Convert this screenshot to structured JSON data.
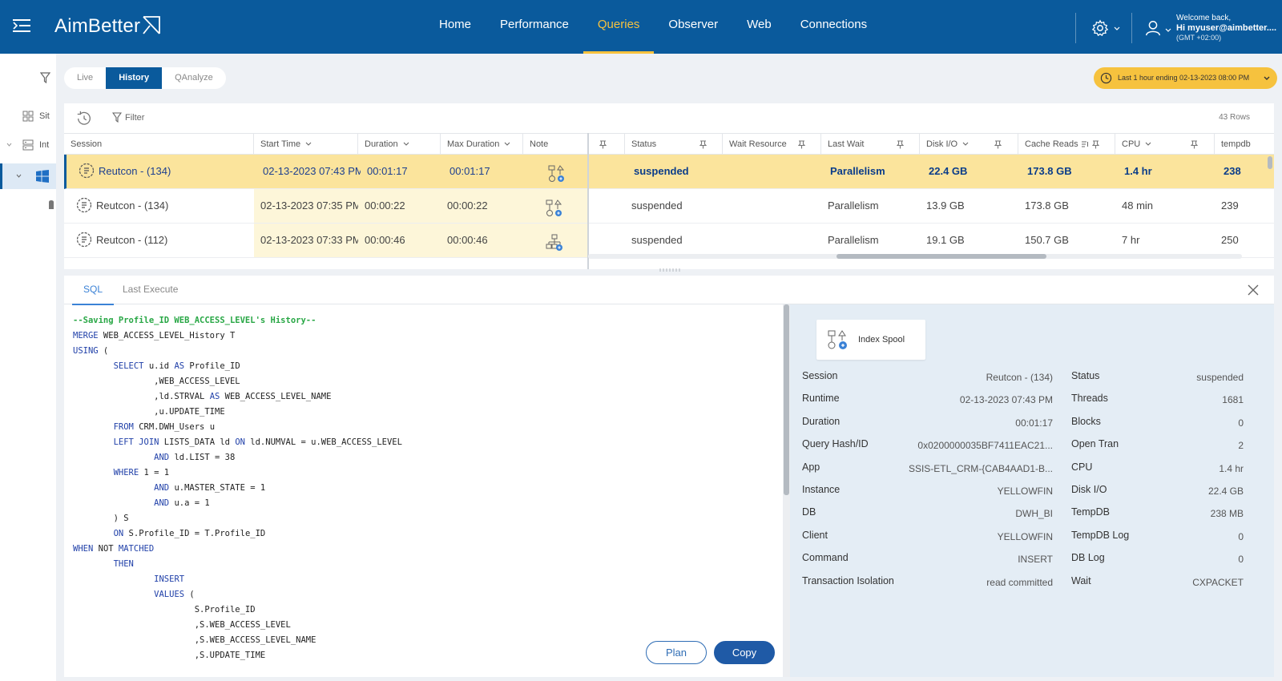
{
  "app": {
    "logo": "AimBetter"
  },
  "nav": {
    "items": [
      "Home",
      "Performance",
      "Queries",
      "Observer",
      "Web",
      "Connections"
    ],
    "active": "Queries"
  },
  "user": {
    "welcome": "Welcome back,",
    "greeting": "Hi myuser@aimbetter....",
    "timezone": "(GMT +02:00)"
  },
  "rail": {
    "items": [
      {
        "label": "Sit",
        "icon": "grid-icon"
      },
      {
        "label": "Int",
        "icon": "server-icon"
      },
      {
        "label": "",
        "icon": "windows-icon"
      }
    ]
  },
  "modes": {
    "items": [
      "Live",
      "History",
      "QAnalyze"
    ],
    "active": "History"
  },
  "time_range": {
    "label": "Last 1 hour ending  02-13-2023 08:00 PM"
  },
  "grid": {
    "filter_label": "Filter",
    "row_count": "43 Rows",
    "columns": [
      "Session",
      "Start Time",
      "Duration",
      "Max Duration",
      "Note",
      "Status",
      "Wait Resource",
      "Last Wait",
      "Disk I/O",
      "Cache Reads",
      "CPU",
      "tempdb"
    ],
    "rows": [
      {
        "session": "Reutcon - (134)",
        "start": "02-13-2023 07:43 PM",
        "duration": "00:01:17",
        "max_duration": "00:01:17",
        "status": "suspended",
        "wait_resource": "",
        "last_wait": "Parallelism",
        "disk_io": "22.4 GB",
        "cache_reads": "173.8 GB",
        "cpu": "1.4 hr",
        "tempdb": "238",
        "selected": true
      },
      {
        "session": "Reutcon - (134)",
        "start": "02-13-2023 07:35 PM",
        "duration": "00:00:22",
        "max_duration": "00:00:22",
        "status": "suspended",
        "wait_resource": "",
        "last_wait": "Parallelism",
        "disk_io": "13.9 GB",
        "cache_reads": "173.8 GB",
        "cpu": "48 min",
        "tempdb": "239",
        "selected": false
      },
      {
        "session": "Reutcon - (112)",
        "start": "02-13-2023 07:33 PM",
        "duration": "00:00:46",
        "max_duration": "00:00:46",
        "status": "suspended",
        "wait_resource": "",
        "last_wait": "Parallelism",
        "disk_io": "19.1 GB",
        "cache_reads": "150.7 GB",
        "cpu": "7 hr",
        "tempdb": "250",
        "selected": false
      }
    ]
  },
  "detail": {
    "tabs": [
      "SQL",
      "Last Execute"
    ],
    "active_tab": "SQL",
    "sql_lines": [
      [
        [
          "--Saving Profile_ID WEB_ACCESS_LEVEL's History--",
          "cm"
        ]
      ],
      [
        [
          "MERGE",
          "k"
        ],
        [
          " WEB_ACCESS_LEVEL_History T",
          ""
        ]
      ],
      [
        [
          "USING",
          "k"
        ],
        [
          " (",
          ""
        ]
      ],
      [
        [
          "        ",
          ""
        ],
        [
          "SELECT",
          "k"
        ],
        [
          " u.id ",
          ""
        ],
        [
          "AS",
          "k"
        ],
        [
          " Profile_ID",
          ""
        ]
      ],
      [
        [
          "                ,WEB_ACCESS_LEVEL",
          ""
        ]
      ],
      [
        [
          "                ,ld.STRVAL ",
          ""
        ],
        [
          "AS",
          "k"
        ],
        [
          " WEB_ACCESS_LEVEL_NAME",
          ""
        ]
      ],
      [
        [
          "                ,u.UPDATE_TIME",
          ""
        ]
      ],
      [
        [
          "        ",
          ""
        ],
        [
          "FROM",
          "k"
        ],
        [
          " CRM.DWH_Users u",
          ""
        ]
      ],
      [
        [
          "        ",
          ""
        ],
        [
          "LEFT JOIN",
          "k"
        ],
        [
          " LISTS_DATA ld ",
          ""
        ],
        [
          "ON",
          "k"
        ],
        [
          " ld.NUMVAL = u.WEB_ACCESS_LEVEL",
          ""
        ]
      ],
      [
        [
          "                ",
          ""
        ],
        [
          "AND",
          "k"
        ],
        [
          " ld.LIST = 38",
          ""
        ]
      ],
      [
        [
          "        ",
          ""
        ],
        [
          "WHERE",
          "k"
        ],
        [
          " 1 = 1",
          ""
        ]
      ],
      [
        [
          "                ",
          ""
        ],
        [
          "AND",
          "k"
        ],
        [
          " u.MASTER_STATE = 1",
          ""
        ]
      ],
      [
        [
          "                ",
          ""
        ],
        [
          "AND",
          "k"
        ],
        [
          " u.a = 1",
          ""
        ]
      ],
      [
        [
          "        ) S",
          ""
        ]
      ],
      [
        [
          "        ",
          ""
        ],
        [
          "ON",
          "k"
        ],
        [
          " S.Profile_ID = T.Profile_ID",
          ""
        ]
      ],
      [
        [
          "WHEN",
          "k"
        ],
        [
          " NOT ",
          ""
        ],
        [
          "MATCHED",
          "k"
        ]
      ],
      [
        [
          "        ",
          ""
        ],
        [
          "THEN",
          "k"
        ]
      ],
      [
        [
          "                ",
          ""
        ],
        [
          "INSERT",
          "k"
        ]
      ],
      [
        [
          "                ",
          ""
        ],
        [
          "VALUES",
          "k"
        ],
        [
          " (",
          ""
        ]
      ],
      [
        [
          "                        S.Profile_ID",
          ""
        ]
      ],
      [
        [
          "                        ,S.WEB_ACCESS_LEVEL",
          ""
        ]
      ],
      [
        [
          "                        ,S.WEB_ACCESS_LEVEL_NAME",
          ""
        ]
      ],
      [
        [
          "                        ,S.UPDATE_TIME",
          ""
        ]
      ]
    ],
    "plan_label": "Plan",
    "copy_label": "Copy",
    "operator": "Index Spool",
    "info_left": [
      [
        "Session",
        "Reutcon - (134)"
      ],
      [
        "Runtime",
        "02-13-2023 07:43 PM"
      ],
      [
        "Duration",
        "00:01:17"
      ],
      [
        "Query Hash/ID",
        "0x0200000035BF7411EAC21..."
      ],
      [
        "App",
        "SSIS-ETL_CRM-{CAB4AAD1-B..."
      ],
      [
        "Instance",
        "YELLOWFIN"
      ],
      [
        "DB",
        "DWH_BI"
      ],
      [
        "Client",
        "YELLOWFIN"
      ],
      [
        "Command",
        "INSERT"
      ],
      [
        "Transaction Isolation",
        "read committed"
      ]
    ],
    "info_right": [
      [
        "Status",
        "suspended"
      ],
      [
        "Threads",
        "1681"
      ],
      [
        "Blocks",
        "0"
      ],
      [
        "Open Tran",
        "2"
      ],
      [
        "CPU",
        "1.4 hr"
      ],
      [
        "Disk I/O",
        "22.4 GB"
      ],
      [
        "TempDB",
        "238 MB"
      ],
      [
        "TempDB Log",
        "0"
      ],
      [
        "DB Log",
        "0"
      ],
      [
        "Wait",
        "CXPACKET"
      ]
    ]
  },
  "colors": {
    "header": "#0a5a9c",
    "accent": "#f6c23e",
    "selected_row": "#fbe49c",
    "info_panel": "#e4edf5"
  }
}
